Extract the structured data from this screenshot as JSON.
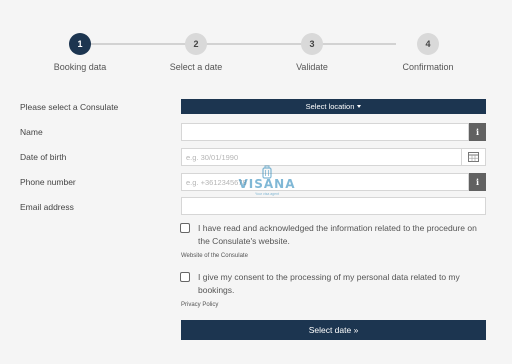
{
  "stepper": {
    "steps": [
      {
        "number": "1",
        "label": "Booking data",
        "active": true
      },
      {
        "number": "2",
        "label": "Select a date",
        "active": false
      },
      {
        "number": "3",
        "label": "Validate",
        "active": false
      },
      {
        "number": "4",
        "label": "Confirmation",
        "active": false
      }
    ]
  },
  "form": {
    "consulate_label": "Please select a Consulate",
    "select_location_label": "Select location",
    "name_label": "Name",
    "name_value": "",
    "dob_label": "Date of birth",
    "dob_placeholder": "e.g. 30/01/1990",
    "phone_label": "Phone number",
    "phone_placeholder": "e.g. +3612345678",
    "email_label": "Email address",
    "email_value": "",
    "consent1_text": "I have read and acknowledged the information related to the procedure on the Consulate's website.",
    "consent1_link": "Website of the Consulate",
    "consent2_text": "I give my consent to the processing of my personal data related to my bookings.",
    "consent2_link": "Privacy Policy",
    "submit_label": "Select date »"
  },
  "watermark": {
    "brand": "VISANA",
    "tagline": "Your visa agent"
  },
  "icons": {
    "info": "info-icon",
    "calendar": "calendar-icon",
    "caret": "caret-down-icon"
  },
  "colors": {
    "primary": "#1c3550",
    "info_button": "#616161",
    "step_inactive": "#d9d9d9"
  }
}
